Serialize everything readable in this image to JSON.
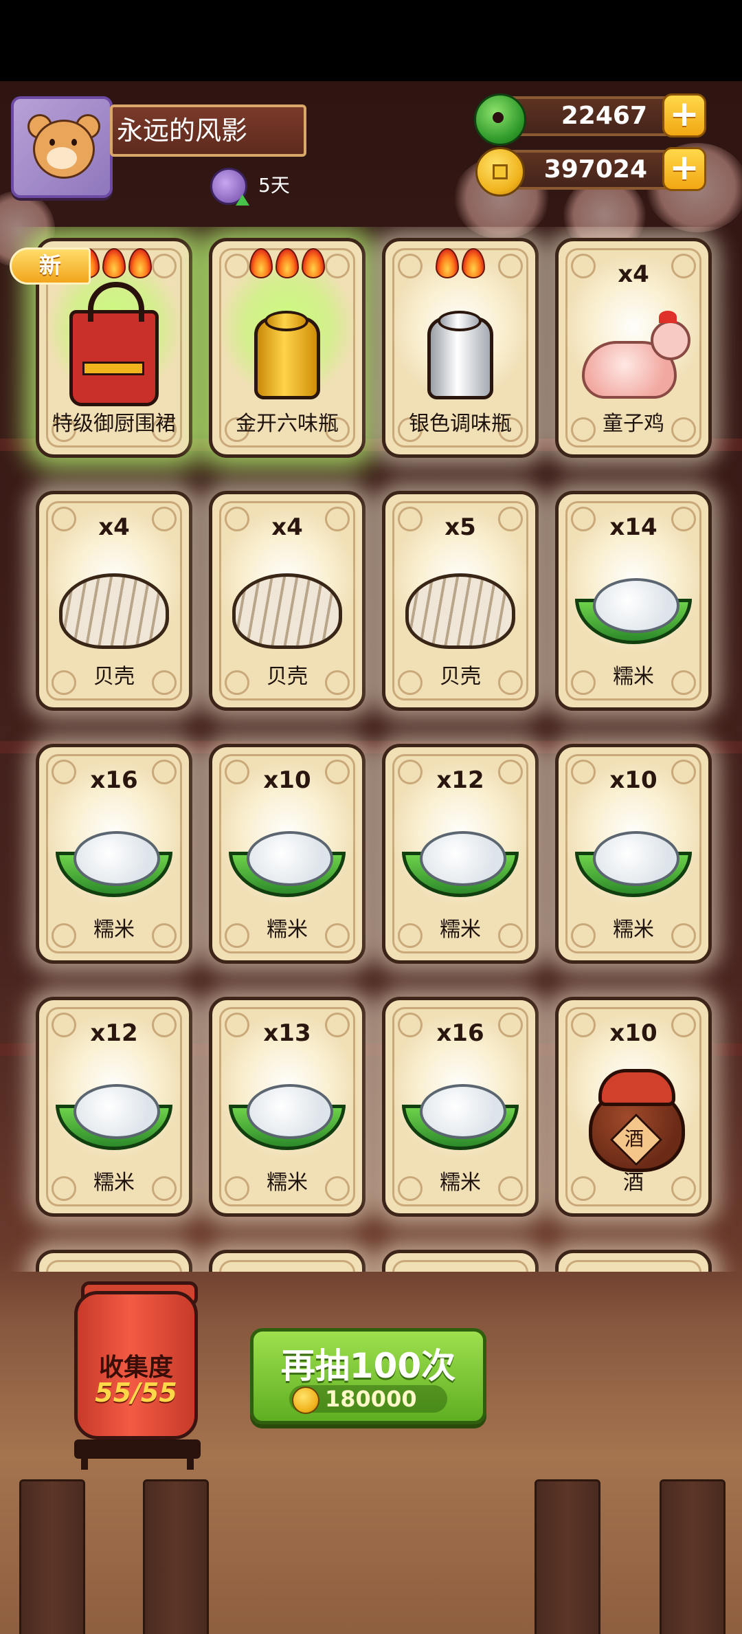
{
  "player": {
    "name": "永远的风影",
    "days": "5天"
  },
  "resources": {
    "jade": "22467",
    "coins": "397024"
  },
  "badges": {
    "new": "新"
  },
  "cards": [
    {
      "label": "特级御厨围裙",
      "count": "",
      "flames": 3,
      "art": "apron-icon",
      "glow": "green"
    },
    {
      "label": "金开六味瓶",
      "count": "",
      "flames": 3,
      "art": "gold-shaker-icon",
      "glow": "green"
    },
    {
      "label": "银色调味瓶",
      "count": "",
      "flames": 2,
      "art": "silver-shaker-icon",
      "glow": "white"
    },
    {
      "label": "童子鸡",
      "count": "x4",
      "flames": 0,
      "art": "chicken-icon",
      "glow": "white"
    },
    {
      "label": "贝壳",
      "count": "x4",
      "flames": 0,
      "art": "clam-icon",
      "glow": "white"
    },
    {
      "label": "贝壳",
      "count": "x4",
      "flames": 0,
      "art": "clam-icon",
      "glow": "white"
    },
    {
      "label": "贝壳",
      "count": "x5",
      "flames": 0,
      "art": "clam-icon",
      "glow": "white"
    },
    {
      "label": "糯米",
      "count": "x14",
      "flames": 0,
      "art": "rice-icon",
      "glow": "white"
    },
    {
      "label": "糯米",
      "count": "x16",
      "flames": 0,
      "art": "rice-icon",
      "glow": "white"
    },
    {
      "label": "糯米",
      "count": "x10",
      "flames": 0,
      "art": "rice-icon",
      "glow": "white"
    },
    {
      "label": "糯米",
      "count": "x12",
      "flames": 0,
      "art": "rice-icon",
      "glow": "white"
    },
    {
      "label": "糯米",
      "count": "x10",
      "flames": 0,
      "art": "rice-icon",
      "glow": "white"
    },
    {
      "label": "糯米",
      "count": "x12",
      "flames": 0,
      "art": "rice-icon",
      "glow": "white"
    },
    {
      "label": "糯米",
      "count": "x13",
      "flames": 0,
      "art": "rice-icon",
      "glow": "white"
    },
    {
      "label": "糯米",
      "count": "x16",
      "flames": 0,
      "art": "rice-icon",
      "glow": "white"
    },
    {
      "label": "酒",
      "count": "x10",
      "flames": 0,
      "art": "wine-jar-icon",
      "glow": "white"
    }
  ],
  "wine_tag": "酒",
  "collection": {
    "label": "收集度",
    "value": "55/55"
  },
  "draw_button": {
    "label": "再抽100次",
    "cost": "180000"
  },
  "colors": {
    "draw_button": "#7cc63a",
    "lantern": "#e14a36",
    "card_bg": "#f1dfb6"
  }
}
